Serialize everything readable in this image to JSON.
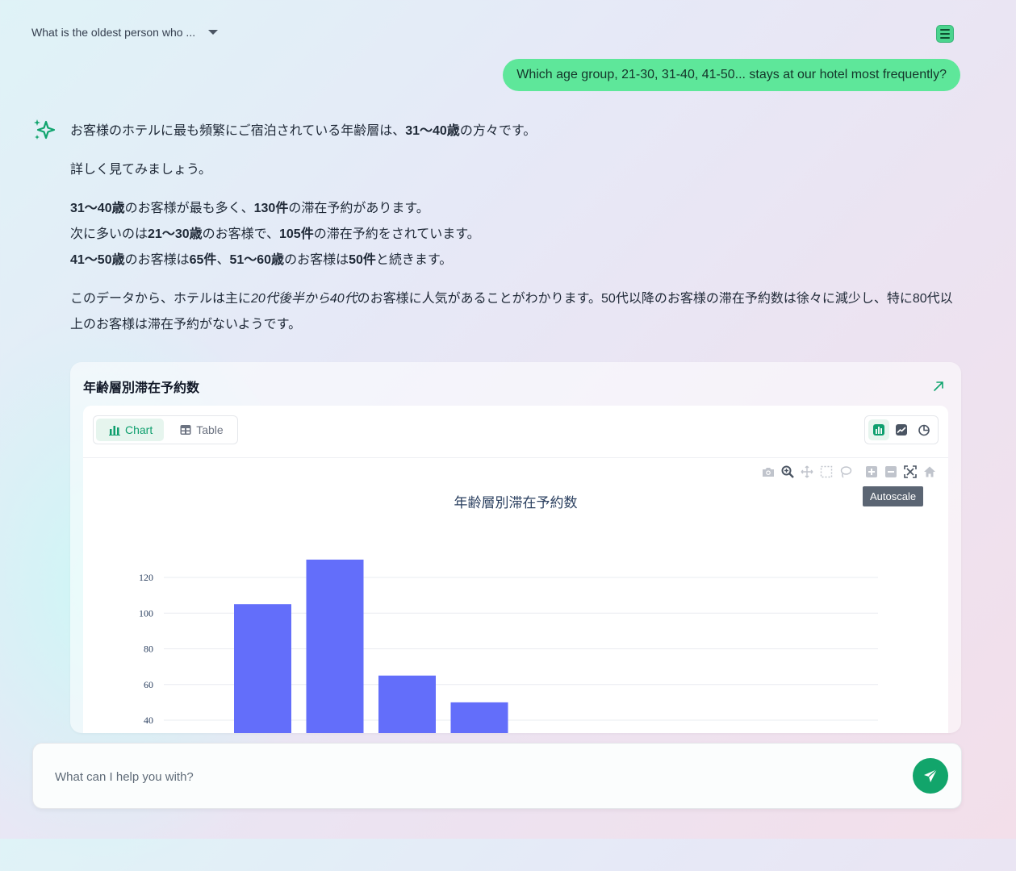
{
  "header": {
    "conversation_title": "What is the oldest person who ...",
    "caret_icon": "chevron-down-icon",
    "menu_icon": "menu-icon"
  },
  "user_message": "Which age group, 21-30, 31-40, 41-50... stays at our hotel most frequently?",
  "answer": {
    "p1_a": "お客様のホテルに最も頻繁にご宿泊されている年齢層は、",
    "p1_b": "31〜40歳",
    "p1_c": "の方々です。",
    "p2": "詳しく見てみましょう。",
    "l1_a": "31〜40歳",
    "l1_b": "のお客様が最も多く、",
    "l1_c": "130件",
    "l1_d": "の滞在予約があります。",
    "l2_a": "次に多いのは",
    "l2_b": "21〜30歳",
    "l2_c": "のお客様で、",
    "l2_d": "105件",
    "l2_e": "の滞在予約をされています。",
    "l3_a": "41〜50歳",
    "l3_b": "のお客様は",
    "l3_c": "65件",
    "l3_d": "、",
    "l3_e": "51〜60歳",
    "l3_f": "のお客様は",
    "l3_g": "50件",
    "l3_h": "と続きます。",
    "p4_a": "このデータから、ホテルは主に",
    "p4_b": "20代後半から40代",
    "p4_c": "のお客様に人気があることがわかります。50代以降のお客様の滞在予約数は徐々に減少し、特に80代以上のお客様は滞在予約がないようです。"
  },
  "card": {
    "title": "年齢層別滞在予約数",
    "tabs": {
      "chart": "Chart",
      "table": "Table"
    },
    "tooltip": "Autoscale",
    "accent_color": "#0e9f6e"
  },
  "chart_data": {
    "type": "bar",
    "title": "年齢層別滞在予約数",
    "values": [
      105,
      130,
      65,
      50
    ],
    "bar_color": "#636efa",
    "y_ticks": [
      40,
      60,
      80,
      100,
      120
    ],
    "grid": true,
    "xlabel": "",
    "ylabel": ""
  },
  "input": {
    "placeholder": "What can I help you with?"
  }
}
